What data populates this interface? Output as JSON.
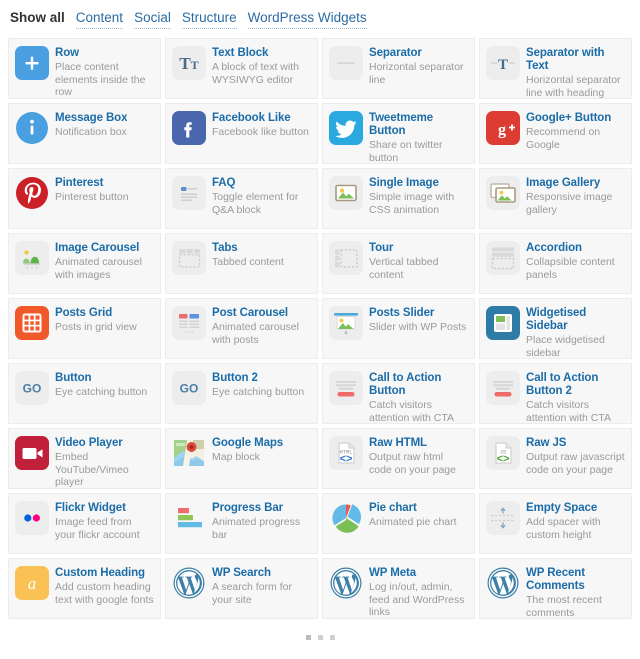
{
  "filters": [
    {
      "label": "Show all",
      "active": true
    },
    {
      "label": "Content",
      "active": false
    },
    {
      "label": "Social",
      "active": false
    },
    {
      "label": "Structure",
      "active": false
    },
    {
      "label": "WordPress Widgets",
      "active": false
    }
  ],
  "cards": [
    {
      "title": "Row",
      "desc": "Place content elements inside the row",
      "icon": "plus-square-icon"
    },
    {
      "title": "Text Block",
      "desc": "A block of text with WYSIWYG editor",
      "icon": "text-block-icon"
    },
    {
      "title": "Separator",
      "desc": "Horizontal separator line",
      "icon": "separator-icon"
    },
    {
      "title": "Separator with Text",
      "desc": "Horizontal separator line with heading",
      "icon": "separator-text-icon"
    },
    {
      "title": "Message Box",
      "desc": "Notification box",
      "icon": "info-circle-icon"
    },
    {
      "title": "Facebook Like",
      "desc": "Facebook like button",
      "icon": "facebook-icon"
    },
    {
      "title": "Tweetmeme Button",
      "desc": "Share on twitter button",
      "icon": "twitter-icon"
    },
    {
      "title": "Google+ Button",
      "desc": "Recommend on Google",
      "icon": "google-plus-icon"
    },
    {
      "title": "Pinterest",
      "desc": "Pinterest button",
      "icon": "pinterest-icon"
    },
    {
      "title": "FAQ",
      "desc": "Toggle element for Q&A block",
      "icon": "faq-icon"
    },
    {
      "title": "Single Image",
      "desc": "Simple image with CSS animation",
      "icon": "single-image-icon"
    },
    {
      "title": "Image Gallery",
      "desc": "Responsive image gallery",
      "icon": "image-gallery-icon"
    },
    {
      "title": "Image Carousel",
      "desc": "Animated carousel with images",
      "icon": "image-carousel-icon"
    },
    {
      "title": "Tabs",
      "desc": "Tabbed content",
      "icon": "tabs-icon"
    },
    {
      "title": "Tour",
      "desc": "Vertical tabbed content",
      "icon": "tour-icon"
    },
    {
      "title": "Accordion",
      "desc": "Collapsible content panels",
      "icon": "accordion-icon"
    },
    {
      "title": "Posts Grid",
      "desc": "Posts in grid view",
      "icon": "posts-grid-icon"
    },
    {
      "title": "Post Carousel",
      "desc": "Animated carousel with posts",
      "icon": "post-carousel-icon"
    },
    {
      "title": "Posts Slider",
      "desc": "Slider with WP Posts",
      "icon": "posts-slider-icon"
    },
    {
      "title": "Widgetised Sidebar",
      "desc": "Place widgetised sidebar",
      "icon": "widgetised-sidebar-icon"
    },
    {
      "title": "Button",
      "desc": "Eye catching button",
      "icon": "go-button-icon"
    },
    {
      "title": "Button 2",
      "desc": "Eye catching button",
      "icon": "go-button-icon"
    },
    {
      "title": "Call to Action Button",
      "desc": "Catch visitors attention with CTA block",
      "icon": "cta-icon"
    },
    {
      "title": "Call to Action Button 2",
      "desc": "Catch visitors attention with CTA block",
      "icon": "cta-icon"
    },
    {
      "title": "Video Player",
      "desc": "Embed YouTube/Vimeo player",
      "icon": "video-camera-icon"
    },
    {
      "title": "Google Maps",
      "desc": "Map block",
      "icon": "google-maps-icon"
    },
    {
      "title": "Raw HTML",
      "desc": "Output raw html code on your page",
      "icon": "raw-html-icon"
    },
    {
      "title": "Raw JS",
      "desc": "Output raw javascript code on your page",
      "icon": "raw-js-icon"
    },
    {
      "title": "Flickr Widget",
      "desc": "Image feed from your flickr account",
      "icon": "flickr-icon"
    },
    {
      "title": "Progress Bar",
      "desc": "Animated progress bar",
      "icon": "progress-bar-icon"
    },
    {
      "title": "Pie chart",
      "desc": "Animated pie chart",
      "icon": "pie-chart-icon"
    },
    {
      "title": "Empty Space",
      "desc": "Add spacer with custom height",
      "icon": "empty-space-icon"
    },
    {
      "title": "Custom Heading",
      "desc": "Add custom heading text with google fonts",
      "icon": "custom-heading-icon"
    },
    {
      "title": "WP Search",
      "desc": "A search form for your site",
      "icon": "wordpress-icon"
    },
    {
      "title": "WP Meta",
      "desc": "Log in/out, admin, feed and WordPress links",
      "icon": "wordpress-icon"
    },
    {
      "title": "WP Recent Comments",
      "desc": "The most recent comments",
      "icon": "wordpress-icon"
    }
  ],
  "pager": {
    "dots": 3,
    "active_index": 0
  },
  "colors": {
    "title": "#1b6ca8",
    "desc": "#9a9a9a",
    "card_bg": "#f7f7f7",
    "link": "#2b6ca3",
    "blue": "#4a9fe0",
    "facebook": "#4a67ad",
    "twitter": "#2aa9e0",
    "google_plus": "#dd3c32",
    "pinterest": "#cb2027",
    "orange": "#f2592a",
    "red": "#c0203a",
    "amber": "#fac154",
    "steel": "#2d7ca8",
    "grey_icon": "#ebebeb"
  }
}
